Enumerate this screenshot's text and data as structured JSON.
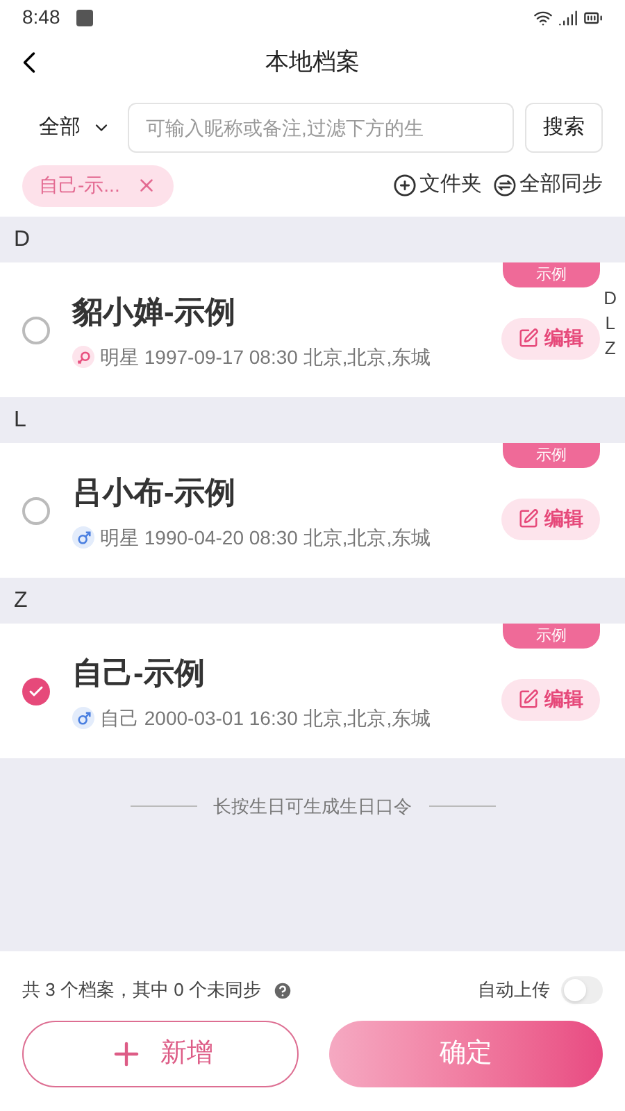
{
  "status_bar": {
    "time": "8:48"
  },
  "header": {
    "title": "本地档案"
  },
  "filter": {
    "category": "全部",
    "placeholder": "可输入昵称或备注,过滤下方的生",
    "search_button": "搜索"
  },
  "chips": [
    {
      "label": "自己-示..."
    }
  ],
  "actions": [
    "文件夹",
    "全部同步"
  ],
  "sections": [
    {
      "letter": "D",
      "items": [
        {
          "name": "貂小婵-示例",
          "tag": "示例",
          "kind": "female",
          "info": "明星 1997-09-17 08:30 北京,北京,东城",
          "edit": "编辑",
          "selected": false
        }
      ]
    },
    {
      "letter": "L",
      "items": [
        {
          "name": "吕小布-示例",
          "tag": "示例",
          "kind": "male",
          "info": "明星 1990-04-20 08:30 北京,北京,东城",
          "edit": "编辑",
          "selected": false
        }
      ]
    },
    {
      "letter": "Z",
      "items": [
        {
          "name": "自己-示例",
          "tag": "示例",
          "kind": "male",
          "info": "自己 2000-03-01 16:30 北京,北京,东城",
          "edit": "编辑",
          "selected": true
        }
      ]
    }
  ],
  "index_letters": [
    "D",
    "L",
    "Z"
  ],
  "hint": "长按生日可生成生日口令",
  "footer": {
    "summary": "共 3 个档案，其中 0 个未同步",
    "auto_upload": {
      "label": "自动上传",
      "on": false
    },
    "add_button": "新增",
    "confirm_button": "确定"
  }
}
